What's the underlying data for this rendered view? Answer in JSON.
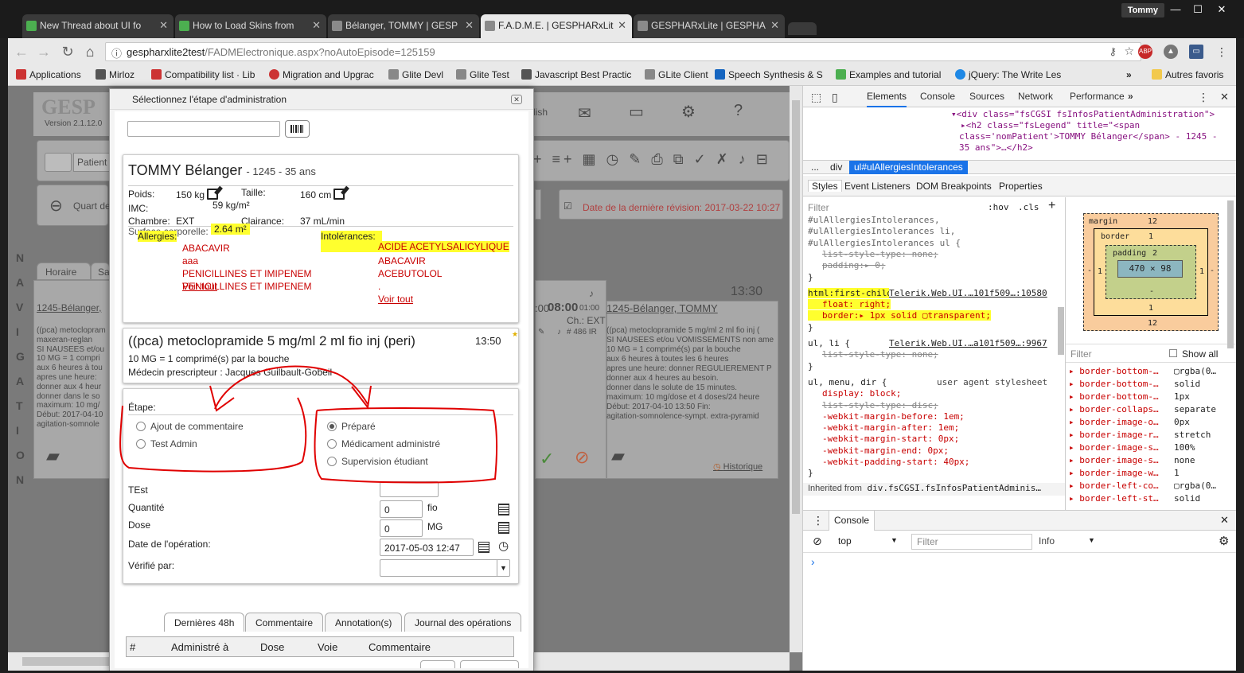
{
  "browser": {
    "tabs": [
      {
        "title": "New Thread about UI fo",
        "color": "#4caf50"
      },
      {
        "title": "How to Load Skins from",
        "color": "#4caf50"
      },
      {
        "title": "Bélanger, TOMMY | GESP",
        "color": "#9e9e9e"
      },
      {
        "title": "F.A.D.M.E. | GESPHARxLit",
        "color": "#9e9e9e"
      },
      {
        "title": "GESPHARxLite | GESPHA",
        "color": "#9e9e9e"
      }
    ],
    "user": "Tommy",
    "url_host": "gespharxlite2test",
    "url_path": "/FADMElectronique.aspx?noAutoEpisode=125159",
    "bookmarks": [
      "Applications",
      "Mirloz",
      "Compatibility list · Lib",
      "Migration and Upgrac",
      "Glite Devl",
      "Glite Test",
      "Javascript Best Practic",
      "GLite Client",
      "Speech Synthesis & S",
      "Examples and tutorial",
      "jQuery: The Write Les"
    ],
    "bookmarks_more": "»",
    "other_bookmarks": "Autres favoris",
    "abp": "ABP"
  },
  "background_app": {
    "logo": "GESP",
    "version": "Version 2.1.12.0",
    "english": "lish",
    "patient_btn": "Patient",
    "quart": "Quart de",
    "revision_label": "Date de la dernière révision:",
    "revision_value": "2017-03-22 10:27",
    "nav_letters": [
      "N",
      "A",
      "V",
      "I",
      "G",
      "A",
      "T",
      "I",
      "O",
      "N"
    ],
    "tab_horaire": "Horaire",
    "tab_sa": "Sa",
    "card_left_title": "1245-Bélanger,",
    "card_left_lines": [
      "((pca) metoclopram",
      "maxeran-reglan",
      "SI NAUSEES et/ou",
      "10 MG = 1 compri",
      "aux 6 heures à tou",
      "apres une heure:",
      "donner aux 4 heur",
      "donner dans le so",
      "maximum: 10 mg/",
      "Début: 2017-04-10",
      "agitation-somnole"
    ],
    "time_0800": "08:00",
    "time_00": ":00",
    "time_0100": "01:00",
    "ch_ext": "Ch.: EXT",
    "num_486": "# 486 IR",
    "time_1330": "13:30",
    "card_right_title": "1245-Bélanger, TOMMY",
    "card_right_lines": [
      "((pca) metoclopramide 5 mg/ml 2 ml fio inj (",
      "SI NAUSEES et/ou VOMISSEMENTS non ame",
      "10 MG = 1 comprimé(s) par la bouche",
      "aux 6 heures à toutes les 6 heures",
      "apres une heure: donner REGULIEREMENT P",
      "donner aux 4 heures au besoin.",
      "donner dans le solute de 15 minutes.",
      "maximum: 10 mg/dose et 4 doses/24 heure",
      "Début: 2017-04-10 13:50 Fin:",
      "agitation-somnolence-sympt. extra-pyramid"
    ],
    "historique": "Historique"
  },
  "modal": {
    "title": "Sélectionnez l'étape d'administration",
    "patient": {
      "name": "TOMMY Bélanger",
      "meta": "- 1245 - 35 ans",
      "poids_label": "Poids:",
      "poids_value": "150 kg",
      "taille_label": "Taille:",
      "taille_value": "160 cm",
      "imc_label": "IMC:",
      "imc_value": "59 kg/m²",
      "chambre_label": "Chambre:",
      "chambre_value": "EXT",
      "clairance_label": "Clairance:",
      "clairance_value": "37 mL/min",
      "surface_label": "Surface corporelle:",
      "surface_value": "2.64 m²",
      "allergies_label": "Allergies:",
      "allergies": [
        "ABACAVIR",
        "aaa",
        "PENICILLINES ET IMIPENEM",
        "PENICILLINES ET IMIPENEM"
      ],
      "allergies_link": "Voir tout",
      "intolerances_label": "Intolérances:",
      "intolerances": [
        "ACIDE ACETYLSALICYLIQUE",
        "ABACAVIR",
        "ACEBUTOLOL",
        "."
      ],
      "intolerances_link": "Voir tout"
    },
    "med": {
      "title": "((pca) metoclopramide 5 mg/ml 2 ml fio inj (peri)",
      "time": "13:50",
      "dose_line": "10 MG = 1 comprimé(s) par la bouche",
      "prescriber": "Médecin prescripteur : Jacques Guilbault-Gobeil"
    },
    "etape": {
      "label": "Étape:",
      "left_options": [
        {
          "label": "Ajout de commentaire",
          "checked": false
        },
        {
          "label": "Test Admin",
          "checked": false
        }
      ],
      "right_options": [
        {
          "label": "Préparé",
          "checked": true
        },
        {
          "label": "Médicament administré",
          "checked": false
        },
        {
          "label": "Supervision étudiant",
          "checked": false
        }
      ]
    },
    "form": {
      "test_label": "TEst",
      "test_value": "",
      "quantite_label": "Quantité",
      "quantite_value": "0",
      "quantite_unit": "fio",
      "dose_label": "Dose",
      "dose_value": "0",
      "dose_unit": "MG",
      "date_label": "Date de l'opération:",
      "date_value": "2017-05-03 12:47",
      "verifie_label": "Vérifié par:",
      "verifie_value": ""
    },
    "tabs": [
      "Dernières 48h",
      "Commentaire",
      "Annotation(s)",
      "Journal des opérations"
    ],
    "grid_columns": [
      "#",
      "Administré à",
      "Dose",
      "Voie",
      "Commentaire"
    ]
  },
  "devtools": {
    "tabs": [
      "Elements",
      "Console",
      "Sources",
      "Network",
      "Performance"
    ],
    "more": "»",
    "dom_lines": [
      "▾<div class=\"fsCGSI fsInfosPatientAdministration\">",
      "▸<h2 class=\"fsLegend\" title=\"<span",
      "class='nomPatient'>TOMMY Bélanger</span> - 1245 -",
      "35 ans\">…</h2>"
    ],
    "crumbs": [
      "...",
      "div",
      "ul#ulAllergiesIntolerances"
    ],
    "subtabs": [
      "Styles",
      "Event Listeners",
      "DOM Breakpoints",
      "Properties"
    ],
    "filter": "Filter",
    "hov": ":hov",
    "cls": ".cls",
    "rule1_selectors": [
      "#ulAllergiesIntolerances,",
      "#ulAllergiesIntolerances li,",
      "#ulAllergiesIntolerances ul {"
    ],
    "rule1_props": [
      "list-style-type: none;",
      "padding:▸ 0;"
    ],
    "rule2_selector": "html:first-child .RadWindow ul {",
    "rule2_source": "Telerik.Web.UI.…101f509…:10580",
    "rule2_props": [
      "float: right;",
      "border:▸ 1px solid ▢transparent;"
    ],
    "rule3_selector": "ul, li {",
    "rule3_source": "Telerik.Web.UI.…a101f509…:9967",
    "rule3_props": [
      "list-style-type: none;"
    ],
    "rule4_selector": "ul, menu, dir {",
    "rule4_source": "user agent stylesheet",
    "rule4_props": [
      "display: block;",
      "list-style-type: disc;",
      "-webkit-margin-before: 1em;",
      "-webkit-margin-after: 1em;",
      "-webkit-margin-start: 0px;",
      "-webkit-margin-end: 0px;",
      "-webkit-padding-start: 40px;"
    ],
    "inherited": "Inherited from",
    "inherited_src": "div.fsCGSI.fsInfosPatientAdminis…",
    "box": {
      "margin": "margin",
      "margin_val": "12",
      "border": "border",
      "border_val": "1",
      "padding": "padding",
      "padding_val": "2",
      "content": "470 × 98",
      "dash": "-"
    },
    "computed_filter": "Filter",
    "show_all": "Show all",
    "computed": [
      [
        "border-bottom-…",
        "▢rgba(0…"
      ],
      [
        "border-bottom-…",
        "solid"
      ],
      [
        "border-bottom-…",
        "1px"
      ],
      [
        "border-collaps…",
        "separate"
      ],
      [
        "border-image-o…",
        "0px"
      ],
      [
        "border-image-r…",
        "stretch"
      ],
      [
        "border-image-s…",
        "100%"
      ],
      [
        "border-image-s…",
        "none"
      ],
      [
        "border-image-w…",
        "1"
      ],
      [
        "border-left-co…",
        "▢rgba(0…"
      ],
      [
        "border-left-st…",
        "solid"
      ]
    ],
    "console_tab": "Console",
    "context": "top",
    "console_filter": "Filter",
    "level": "Info",
    "prompt": "›"
  }
}
